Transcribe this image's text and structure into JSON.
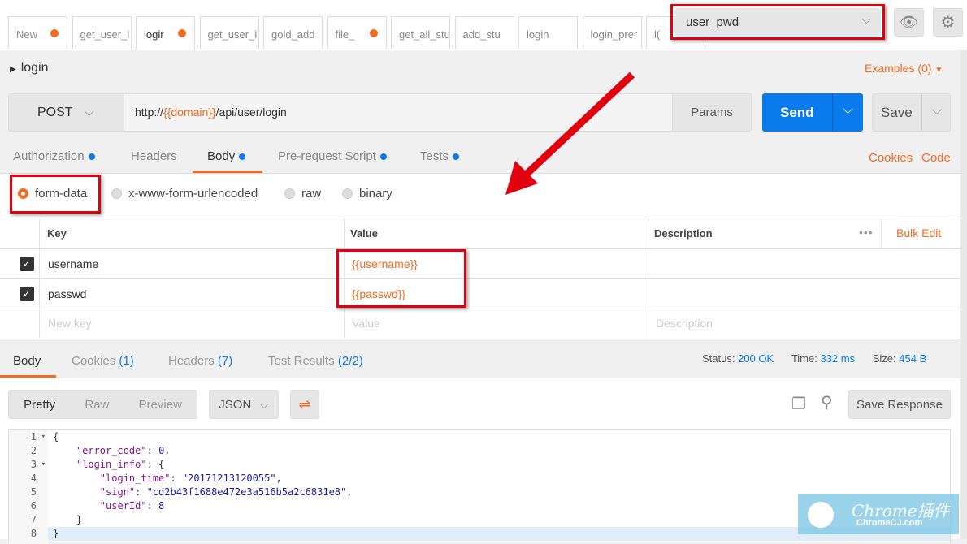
{
  "tabs": [
    {
      "label": "New",
      "dirty": true
    },
    {
      "label": "get_user_i",
      "dirty": false
    },
    {
      "label": "logir",
      "dirty": true,
      "active": true
    },
    {
      "label": "get_user_i",
      "dirty": false
    },
    {
      "label": "gold_add",
      "dirty": false
    },
    {
      "label": "file_",
      "dirty": true
    },
    {
      "label": "get_all_stu",
      "dirty": false
    },
    {
      "label": "add_stu",
      "dirty": false
    },
    {
      "label": "login",
      "dirty": false
    },
    {
      "label": "login_prer",
      "dirty": false
    },
    {
      "label": "l(",
      "dirty": false
    }
  ],
  "environment": {
    "selected": "user_pwd"
  },
  "request": {
    "name": "login",
    "examples": "Examples (0)",
    "method": "POST",
    "url_prefix": "http://",
    "url_var": "{{domain}}",
    "url_suffix": "/api/user/login",
    "params": "Params",
    "send": "Send",
    "save": "Save"
  },
  "req_tabs": {
    "authorization": "Authorization",
    "headers": "Headers",
    "body": "Body",
    "prerequest": "Pre-request Script",
    "tests": "Tests",
    "cookies": "Cookies",
    "code": "Code"
  },
  "body_types": {
    "form_data": "form-data",
    "urlencoded": "x-www-form-urlencoded",
    "raw": "raw",
    "binary": "binary"
  },
  "table": {
    "headers": {
      "key": "Key",
      "value": "Value",
      "description": "Description",
      "bulk_edit": "Bulk Edit"
    },
    "rows": [
      {
        "key": "username",
        "value": "{{username}}"
      },
      {
        "key": "passwd",
        "value": "{{passwd}}"
      }
    ],
    "placeholders": {
      "key": "New key",
      "value": "Value",
      "description": "Description"
    }
  },
  "response": {
    "tabs": {
      "body": "Body",
      "cookies": "Cookies",
      "cookies_count": "(1)",
      "headers": "Headers",
      "headers_count": "(7)",
      "tests": "Test Results",
      "tests_count": "(2/2)"
    },
    "status_label": "Status:",
    "status": "200 OK",
    "time_label": "Time:",
    "time": "332 ms",
    "size_label": "Size:",
    "size": "454 B",
    "views": {
      "pretty": "Pretty",
      "raw": "Raw",
      "preview": "Preview"
    },
    "format": "JSON",
    "save_response": "Save Response",
    "lines": [
      "1",
      "2",
      "3",
      "4",
      "5",
      "6",
      "7",
      "8"
    ],
    "json": {
      "error_code_key": "\"error_code\"",
      "error_code": "0",
      "login_info_key": "\"login_info\"",
      "login_time_key": "\"login_time\"",
      "login_time": "\"20171213120055\"",
      "sign_key": "\"sign\"",
      "sign": "\"cd2b43f1688e472e3a516b5a2c6831e8\"",
      "userId_key": "\"userId\"",
      "userId": "8"
    }
  },
  "watermark": {
    "title": "Chrome插件",
    "site": "ChromeCJ.com"
  },
  "colors": {
    "accent": "#f26b21",
    "send": "#097bed",
    "highlight_box": "#e0000e"
  }
}
